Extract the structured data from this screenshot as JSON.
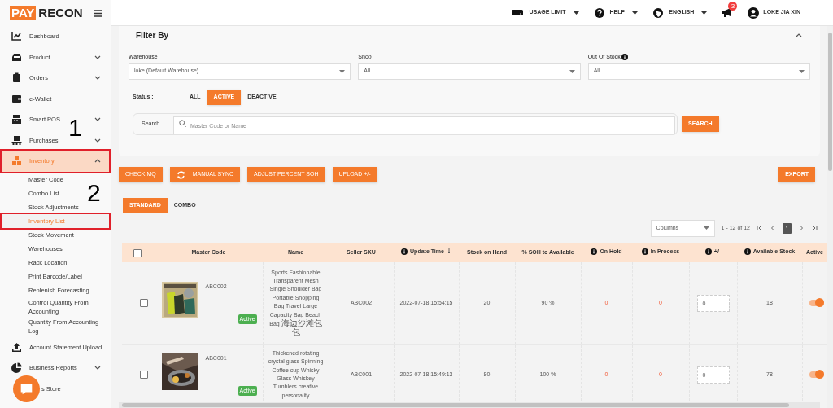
{
  "logo": {
    "part_1": "PAY",
    "part_2": "RECON"
  },
  "sidebar": {
    "items": [
      {
        "label": "Dashboard",
        "kind": "link",
        "selected": false,
        "outlined": false
      },
      {
        "label": "Product",
        "kind": "group",
        "expanded": false,
        "selected": false,
        "outlined": false
      },
      {
        "label": "Orders",
        "kind": "group",
        "expanded": false,
        "selected": false,
        "outlined": false
      },
      {
        "label": "e-Wallet",
        "kind": "link",
        "selected": false,
        "outlined": false
      },
      {
        "label": "Smart POS",
        "kind": "group",
        "expanded": false,
        "selected": false,
        "outlined": false
      },
      {
        "label": "Purchases",
        "kind": "group",
        "expanded": false,
        "selected": false,
        "outlined": false
      },
      {
        "label": "Inventory",
        "kind": "group",
        "expanded": true,
        "selected": true,
        "outlined": true,
        "children": [
          {
            "label": "Master Code",
            "selected": false,
            "outlined": false
          },
          {
            "label": "Combo List",
            "selected": false,
            "outlined": false
          },
          {
            "label": "Stock Adjustments",
            "selected": false,
            "outlined": false
          },
          {
            "label": "Inventory List",
            "selected": true,
            "outlined": true
          },
          {
            "label": "Stock Movement",
            "selected": false,
            "outlined": false
          },
          {
            "label": "Warehouses",
            "selected": false,
            "outlined": false
          },
          {
            "label": "Rack Location",
            "selected": false,
            "outlined": false
          },
          {
            "label": "Print Barcode/Label",
            "selected": false,
            "outlined": false
          },
          {
            "label": "Replenish Forecasting",
            "selected": false,
            "outlined": false
          },
          {
            "label": "Control Quantity From Accounting",
            "selected": false,
            "outlined": false
          },
          {
            "label": "Quantity From Accounting Log",
            "selected": false,
            "outlined": false
          }
        ]
      },
      {
        "label": "Account Statement Upload",
        "kind": "link",
        "selected": false,
        "outlined": false
      },
      {
        "label": "Business Reports",
        "kind": "group",
        "expanded": false,
        "selected": false,
        "outlined": false
      },
      {
        "label": "s Store",
        "kind": "link",
        "selected": false,
        "outlined": false
      }
    ]
  },
  "annotations": [
    "1",
    "2"
  ],
  "header": {
    "items": [
      {
        "label": "USAGE LIMIT"
      },
      {
        "label": "HELP"
      },
      {
        "label": "ENGLISH"
      }
    ],
    "notifications": {
      "count": "3"
    },
    "user": "LOKE JIA XIN"
  },
  "filter": {
    "title": "Filter By",
    "fields": [
      {
        "label": "Warehouse",
        "value": "loke (Default Warehouse)",
        "kind": "plain"
      },
      {
        "label": "Shop",
        "value": "All",
        "kind": "plain"
      },
      {
        "label": "Out Of Stock",
        "value": "All",
        "kind": "info"
      }
    ],
    "status_label": "Status :",
    "status_options": [
      {
        "label": "ALL",
        "selected": false
      },
      {
        "label": "ACTIVE",
        "selected": true
      },
      {
        "label": "DEACTIVE",
        "selected": false
      }
    ],
    "search_label": "Search",
    "search_placeholder": "Master Code or Name",
    "search_button": "SEARCH"
  },
  "actions": [
    {
      "label": "CHECK MQ",
      "kind": "plain"
    },
    {
      "label": "MANUAL SYNC",
      "kind": "sync"
    },
    {
      "label": "ADJUST PERCENT SOH",
      "kind": "plain"
    },
    {
      "label": "UPLOAD +/-",
      "kind": "plain"
    }
  ],
  "export_button": "EXPORT",
  "tabs": [
    {
      "label": "STANDARD",
      "selected": true
    },
    {
      "label": "COMBO",
      "selected": false
    }
  ],
  "columns_select": "Columns",
  "pagination": {
    "range": "1 - 12 of 12",
    "page": "1"
  },
  "table": {
    "all_checked": false,
    "columns": [
      {
        "label": "Master Code",
        "kind": "plain"
      },
      {
        "label": "Name",
        "kind": "plain"
      },
      {
        "label": "Seller SKU",
        "kind": "plain"
      },
      {
        "label": "Update Time",
        "kind": "info_sort"
      },
      {
        "label": "Stock on Hand",
        "kind": "plain"
      },
      {
        "label": "% SOH to Available",
        "kind": "plain"
      },
      {
        "label": "On Hold",
        "kind": "info"
      },
      {
        "label": "In Process",
        "kind": "info"
      },
      {
        "label": "+/-",
        "kind": "info"
      },
      {
        "label": "Available Stock",
        "kind": "info"
      },
      {
        "label": "Active",
        "kind": "plain"
      }
    ],
    "rows": [
      {
        "checked": false,
        "code": "ABC002",
        "status": "Active",
        "name": "Sports Fashionable Transparent Mesh Single Shoulder Bag Portable Shopping Bag Travel Large Capacity Bag Beach Bag 海边沙滩包包",
        "sku": "ABC002",
        "updated": "2022-07-18 15:54:15",
        "stock_on_hand": "20",
        "soh_percent": "90 %",
        "on_hold": "0",
        "in_process": "0",
        "adjust": "0",
        "available": "18",
        "active": true
      },
      {
        "checked": false,
        "code": "ABC001",
        "status": "Active",
        "name": "Thickened rotating crystal glass Spinning Coffee cup Whisky Glass Whiskey Tumblers creative personality",
        "sku": "ABC001",
        "updated": "2022-07-18 15:49:13",
        "stock_on_hand": "80",
        "soh_percent": "100 %",
        "on_hold": "0",
        "in_process": "0",
        "adjust": "0",
        "available": "78",
        "active": true
      }
    ]
  }
}
